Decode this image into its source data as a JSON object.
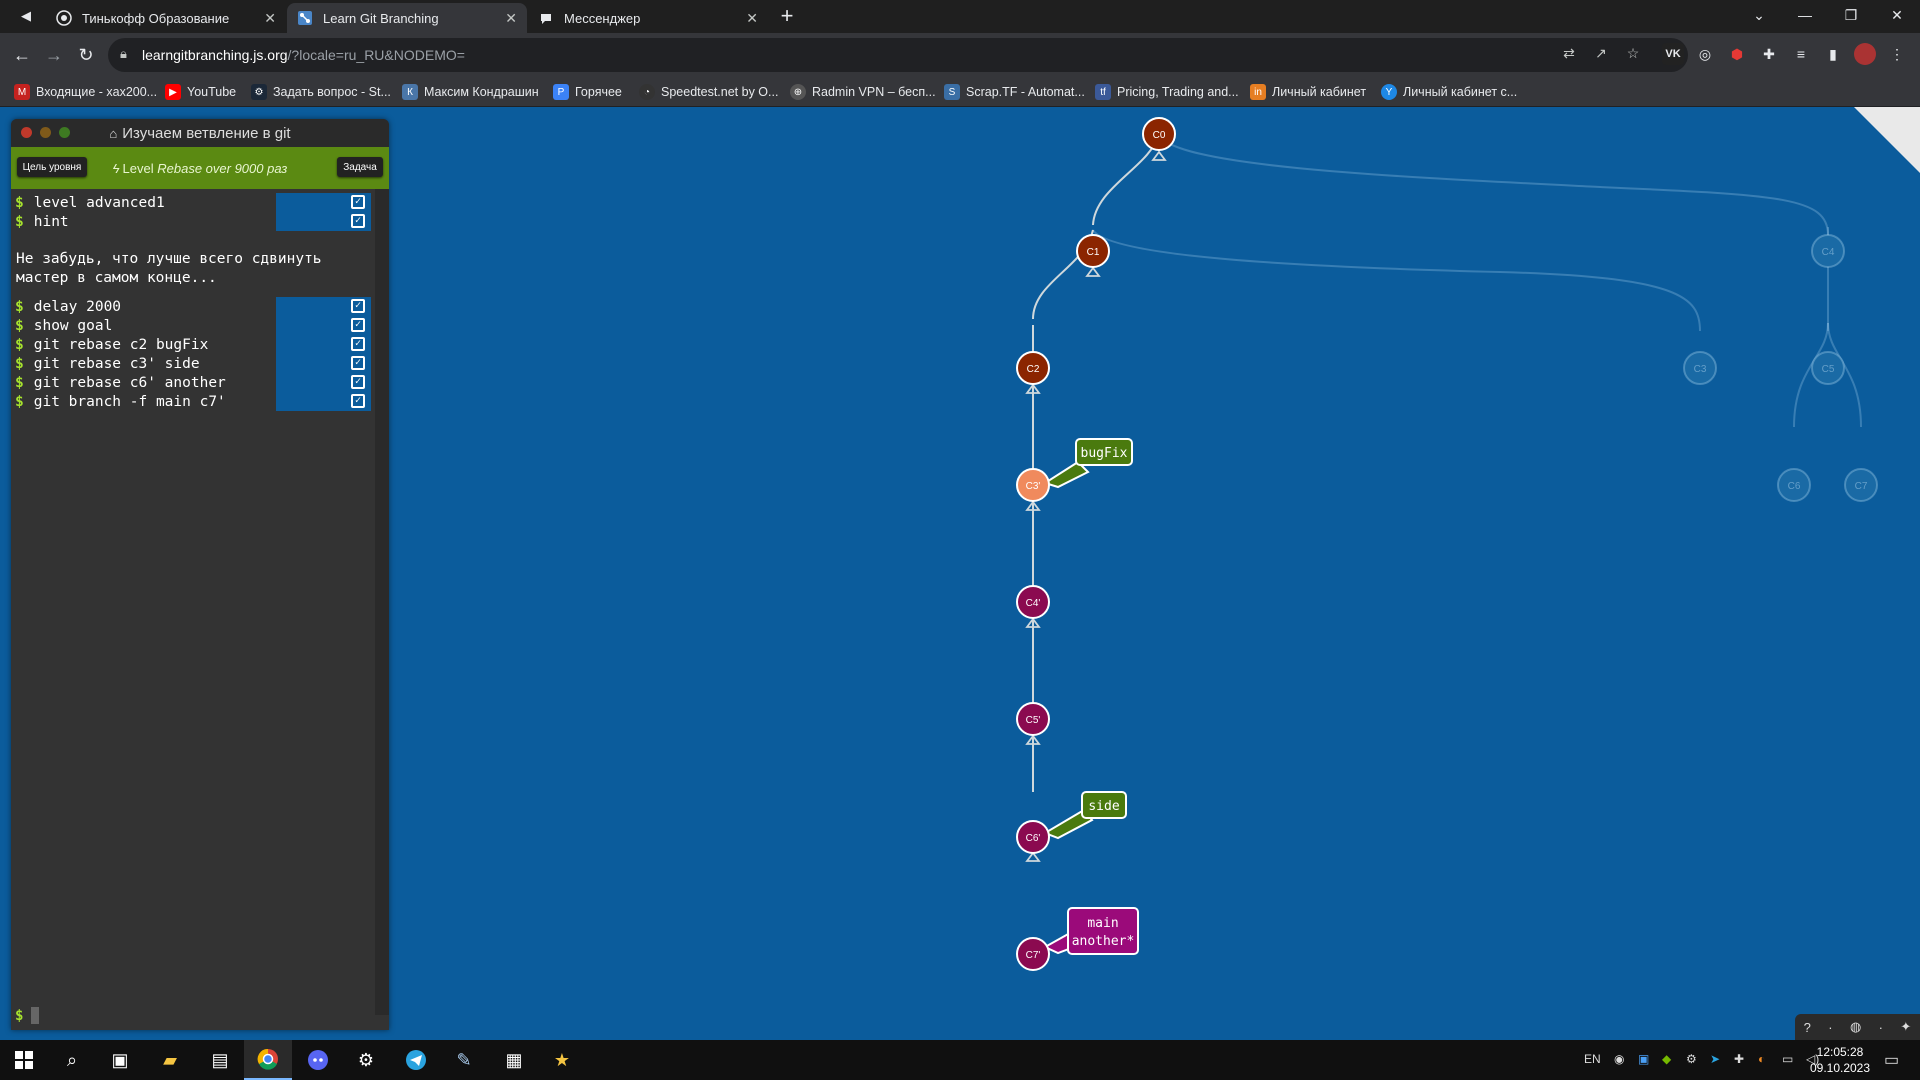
{
  "browser": {
    "tabs": [
      {
        "title": "Тинькофф Образование",
        "icon": "tinkoff-icon"
      },
      {
        "title": "Learn Git Branching",
        "icon": "learngit-icon",
        "active": true
      },
      {
        "title": "Мессенджер",
        "icon": "messenger-icon"
      }
    ],
    "url_host": "learngitbranching.js.org",
    "url_path": "/?locale=ru_RU&NODEMO=",
    "bookmarks": [
      {
        "label": "Входящие - xax200...",
        "icon": "gmail-icon",
        "color": "#c5221f"
      },
      {
        "label": "YouTube",
        "icon": "youtube-icon",
        "color": "#ff0000"
      },
      {
        "label": "Задать вопрос - St...",
        "icon": "steam-icon",
        "color": "#1b2838"
      },
      {
        "label": "Максим Кондрашин",
        "icon": "vk-icon",
        "color": "#4a76a8"
      },
      {
        "label": "Горячее",
        "icon": "pikabu-icon",
        "color": "#3b82f6"
      },
      {
        "label": "Speedtest.net by O...",
        "icon": "speedtest-icon",
        "color": "#333"
      },
      {
        "label": "Radmin VPN – бесп...",
        "icon": "radmin-icon",
        "color": "#555"
      },
      {
        "label": "Scrap.TF - Automat...",
        "icon": "scrap-icon",
        "color": "#3a6ea5"
      },
      {
        "label": "Pricing, Trading and...",
        "icon": "trading-icon",
        "color": "#3b5998"
      },
      {
        "label": "Личный кабинет",
        "icon": "cabinet-icon",
        "color": "#e67e22"
      },
      {
        "label": "Личный кабинет с...",
        "icon": "cabinet2-icon",
        "color": "#1e88e5"
      }
    ]
  },
  "terminal": {
    "title": "Изучаем ветвление в git",
    "goal_button": "Цель уровня",
    "task_button": "Задача",
    "level_prefix": "Level ",
    "level_name": "Rebase over 9000 раз",
    "commands_top": [
      "level advanced1",
      "hint"
    ],
    "hint_text": "Не забудь, что лучше всего сдвинуть мастер в самом конце...",
    "commands_bottom": [
      "delay 2000",
      "show goal",
      "git rebase c2 bugFix",
      "git rebase c3' side",
      "git rebase c6' another",
      "git branch -f main c7'"
    ],
    "prompt": "$"
  },
  "graph": {
    "commits": [
      {
        "id": "C0",
        "color": "#8b2500"
      },
      {
        "id": "C1",
        "color": "#8b2500"
      },
      {
        "id": "C2",
        "color": "#8b2500"
      },
      {
        "id": "C3'",
        "color": "#f08a5d"
      },
      {
        "id": "C4'",
        "color": "#8b0a50"
      },
      {
        "id": "C5'",
        "color": "#8b0a50"
      },
      {
        "id": "C6'",
        "color": "#8b0a50"
      },
      {
        "id": "C7'",
        "color": "#8b0a50"
      },
      {
        "id": "C4",
        "faded": true
      },
      {
        "id": "C3",
        "faded": true
      },
      {
        "id": "C5",
        "faded": true
      },
      {
        "id": "C6",
        "faded": true
      },
      {
        "id": "C7",
        "faded": true
      }
    ],
    "branches": [
      {
        "name": "bugFix",
        "target": "C3'",
        "color": "#4a7a0e"
      },
      {
        "name": "side",
        "target": "C6'",
        "color": "#4a7a0e"
      },
      {
        "name": "main\nanother*",
        "target": "C7'",
        "color": "#9b0a7a"
      }
    ]
  },
  "taskbar": {
    "lang": "EN",
    "time": "12:05:28",
    "date": "09.10.2023"
  }
}
